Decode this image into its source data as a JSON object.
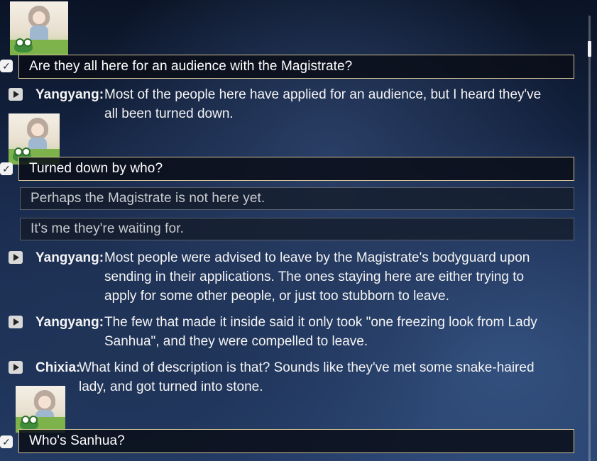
{
  "dialogue_log": {
    "entries": [
      {
        "type": "choice",
        "selected": true,
        "text": "Are they all here for an audience with the Magistrate?"
      },
      {
        "type": "line",
        "speaker": "Yangyang:",
        "lines": [
          "Most of the people here have applied for an audience, but I heard they've",
          "all been turned down."
        ]
      },
      {
        "type": "choice",
        "selected": true,
        "text": "Turned down by who?"
      },
      {
        "type": "choice",
        "selected": false,
        "text": "Perhaps the Magistrate is not here yet."
      },
      {
        "type": "choice",
        "selected": false,
        "text": "It's me they're waiting for."
      },
      {
        "type": "line",
        "speaker": "Yangyang:",
        "lines": [
          "Most people were advised to leave by the Magistrate's bodyguard upon",
          "sending in their applications. The ones staying here are either trying to",
          "apply for some other people, or just too stubborn to leave."
        ]
      },
      {
        "type": "line",
        "speaker": "Yangyang:",
        "lines": [
          "The few that made it inside said it only took \"one freezing look from Lady",
          "Sanhua\", and they were compelled to leave."
        ]
      },
      {
        "type": "line",
        "speaker": "Chixia:",
        "lines": [
          "What kind of description is that? Sounds like they've met some snake-haired",
          "lady, and got turned into stone."
        ]
      },
      {
        "type": "choice",
        "selected": true,
        "text": "Who's Sanhua?"
      }
    ]
  },
  "icons": {
    "check": "checkmark-icon",
    "play": "play-voice-icon",
    "avatar": "player-avatar"
  },
  "colors": {
    "selected_border": "#f5e1aa",
    "text": "#f4f4f4",
    "unselected_text": "#c8cbcf"
  }
}
